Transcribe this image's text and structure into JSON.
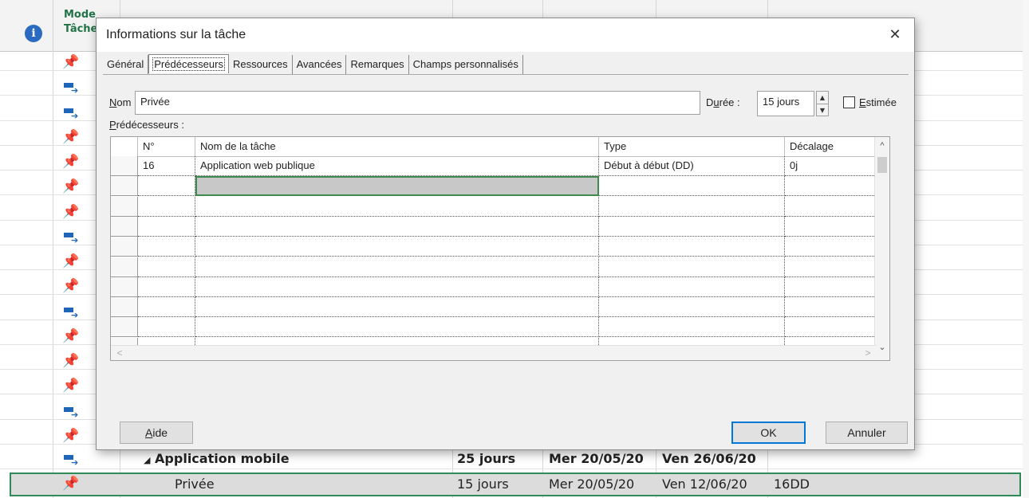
{
  "background": {
    "header_line1": "Mode",
    "header_line2": "Tâche",
    "rows": [
      {
        "icon": "pin"
      },
      {
        "icon": "auto"
      },
      {
        "icon": "auto"
      },
      {
        "icon": "pin"
      },
      {
        "icon": "pin"
      },
      {
        "icon": "pin"
      },
      {
        "icon": "pin"
      },
      {
        "icon": "auto"
      },
      {
        "icon": "pin"
      },
      {
        "icon": "pin"
      },
      {
        "icon": "auto"
      },
      {
        "icon": "pin"
      },
      {
        "icon": "pin"
      },
      {
        "icon": "pin"
      },
      {
        "icon": "auto"
      },
      {
        "icon": "pin"
      }
    ],
    "summary_row": {
      "name": "Application mobile",
      "duration": "25 jours",
      "start": "Mer 20/05/20",
      "finish": "Ven 26/06/20",
      "predecessors": ""
    },
    "selected_row": {
      "name": "Privée",
      "duration": "15 jours",
      "start": "Mer 20/05/20",
      "finish": "Ven 12/06/20",
      "predecessors": "16DD"
    }
  },
  "dialog": {
    "title": "Informations sur la tâche",
    "close": "✕",
    "tabs": [
      "Général",
      "Prédécesseurs",
      "Ressources",
      "Avancées",
      "Remarques",
      "Champs personnalisés"
    ],
    "active_tab": "Prédécesseurs",
    "name_label_u": "N",
    "name_label_rest": "om :",
    "name_value": "Privée",
    "duration_label_pre": "D",
    "duration_label_u": "u",
    "duration_label_rest": "rée :",
    "duration_value": "15 jours",
    "estimated_label_u": "E",
    "estimated_label_rest": "stimée",
    "estimated_checked": false,
    "predecessors_label_u": "P",
    "predecessors_label_rest": "rédécesseurs :",
    "columns": [
      "N°",
      "Nom de la tâche",
      "Type",
      "Décalage"
    ],
    "rows": [
      {
        "num": "16",
        "name": "Application web publique",
        "type": "Début à début (DD)",
        "lag": "0j"
      }
    ],
    "help_button_u": "A",
    "help_button_rest": "ide",
    "ok_button": "OK",
    "cancel_button": "Annuler"
  }
}
